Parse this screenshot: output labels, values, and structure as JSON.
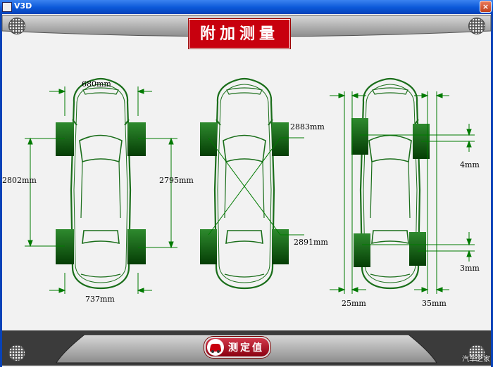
{
  "window": {
    "title": "V3D",
    "close": "×"
  },
  "page": {
    "title": "附加测量"
  },
  "measure_button": {
    "label": "测定值"
  },
  "measurements": {
    "front_track": "680mm",
    "rear_track": "737mm",
    "wheelbase_left": "2802mm",
    "wheelbase_right": "2795mm",
    "diagonal_1": "2883mm",
    "diagonal_2": "2891mm",
    "front_offset": "4mm",
    "rear_offset": "3mm",
    "left_offset": "25mm",
    "right_offset": "35mm"
  },
  "watermark": "汽车之家",
  "colors": {
    "car_outline": "#1a6e1a",
    "wheel": "#0b5a0b",
    "dimension": "#007a00",
    "title_bg": "#c8000e"
  }
}
